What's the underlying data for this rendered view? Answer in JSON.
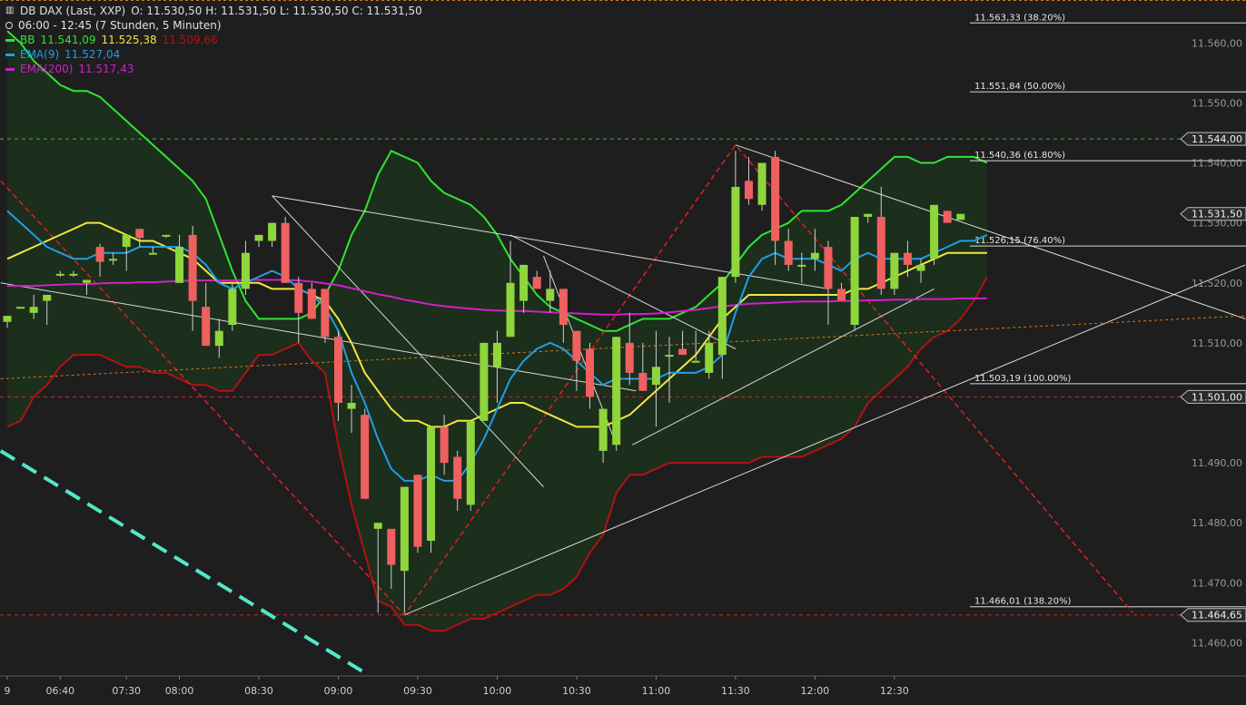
{
  "header": {
    "instrument": "DB DAX (Last, XXP)",
    "ohlc": "O: 11.530,50  H: 11.531,50  L: 11.530,50  C: 11.531,50",
    "timerange": "06:00 - 12:45 (7 Stunden, 5 Minuten)",
    "bb_label": "BB",
    "bb_upper": "11.541,09",
    "bb_mid": "11.525,38",
    "bb_lower": "11.509,66",
    "ema9_label": "EMA(9)",
    "ema9_value": "11.527,04",
    "ema200_label": "EMA(200)",
    "ema200_value": "11.517,43"
  },
  "colors": {
    "background": "#1e1e1e",
    "bb_fill": "#1c2e1c",
    "bb_upper": "#2fe52f",
    "bb_lower": "#b21212",
    "bb_mid": "#f0e640",
    "ema9": "#1f9ee8",
    "ema200": "#d020c8",
    "candle_up": "#8ed63c",
    "candle_down": "#ef6060",
    "fib_line": "#d8d8d8",
    "red_dashed": "#e02020",
    "green_dashed": "#30c030",
    "cyan_dashed": "#50e8c8",
    "orange_dotted": "#d07a1a"
  },
  "chart_data": {
    "type": "candlestick",
    "y_range": [
      11455,
      11567
    ],
    "x_range": [
      0,
      85
    ],
    "y_ticks": [
      "11.560,00",
      "11.550,00",
      "11.540,00",
      "11.530,00",
      "11.520,00",
      "11.510,00",
      "11.490,00",
      "11.480,00",
      "11.470,00",
      "11.460,00"
    ],
    "y_tick_values": [
      11560,
      11550,
      11540,
      11530,
      11520,
      11510,
      11490,
      11480,
      11470,
      11460
    ],
    "x_ticks": [
      {
        "label": "9",
        "bar": 0
      },
      {
        "label": "06:40",
        "bar": 4
      },
      {
        "label": "07:30",
        "bar": 9
      },
      {
        "label": "08:00",
        "bar": 13
      },
      {
        "label": "08:30",
        "bar": 19
      },
      {
        "label": "09:00",
        "bar": 25
      },
      {
        "label": "09:30",
        "bar": 31
      },
      {
        "label": "10:00",
        "bar": 37
      },
      {
        "label": "10:30",
        "bar": 43
      },
      {
        "label": "11:00",
        "bar": 49
      },
      {
        "label": "11:30",
        "bar": 55
      },
      {
        "label": "12:00",
        "bar": 61
      },
      {
        "label": "12:30",
        "bar": 67
      }
    ],
    "candles": [
      {
        "o": 11513.5,
        "h": 11514.5,
        "l": 11512.5,
        "c": 11514.5
      },
      {
        "o": 11516,
        "h": 11516,
        "l": 11516,
        "c": 11516
      },
      {
        "o": 11515,
        "h": 11518,
        "l": 11514,
        "c": 11516
      },
      {
        "o": 11517,
        "h": 11518,
        "l": 11513,
        "c": 11518
      },
      {
        "o": 11521.5,
        "h": 11522,
        "l": 11521,
        "c": 11521.5
      },
      {
        "o": 11521.5,
        "h": 11522,
        "l": 11521,
        "c": 11521.5
      },
      {
        "o": 11520,
        "h": 11520.5,
        "l": 11518,
        "c": 11520.5
      },
      {
        "o": 11526,
        "h": 11526.5,
        "l": 11521,
        "c": 11523.5
      },
      {
        "o": 11524,
        "h": 11525,
        "l": 11523,
        "c": 11524
      },
      {
        "o": 11526,
        "h": 11527,
        "l": 11522,
        "c": 11528
      },
      {
        "o": 11529,
        "h": 11529,
        "l": 11526,
        "c": 11527.5
      },
      {
        "o": 11525,
        "h": 11526,
        "l": 11525,
        "c": 11525
      },
      {
        "o": 11528,
        "h": 11528,
        "l": 11527.5,
        "c": 11528
      },
      {
        "o": 11520,
        "h": 11528,
        "l": 11520,
        "c": 11526
      },
      {
        "o": 11528,
        "h": 11529.5,
        "l": 11512,
        "c": 11517
      },
      {
        "o": 11516,
        "h": 11520,
        "l": 11510,
        "c": 11509.5
      },
      {
        "o": 11509.5,
        "h": 11514,
        "l": 11507.5,
        "c": 11512
      },
      {
        "o": 11513,
        "h": 11520,
        "l": 11512,
        "c": 11519
      },
      {
        "o": 11519,
        "h": 11527,
        "l": 11518,
        "c": 11525
      },
      {
        "o": 11527,
        "h": 11528,
        "l": 11526,
        "c": 11528
      },
      {
        "o": 11527,
        "h": 11529,
        "l": 11526,
        "c": 11530
      },
      {
        "o": 11530,
        "h": 11531,
        "l": 11520,
        "c": 11520
      },
      {
        "o": 11520,
        "h": 11521,
        "l": 11510,
        "c": 11515
      },
      {
        "o": 11519,
        "h": 11520,
        "l": 11514,
        "c": 11514
      },
      {
        "o": 11519,
        "h": 11519,
        "l": 11510,
        "c": 11511
      },
      {
        "o": 11511,
        "h": 11512,
        "l": 11497,
        "c": 11500
      },
      {
        "o": 11499,
        "h": 11503,
        "l": 11495,
        "c": 11500
      },
      {
        "o": 11498,
        "h": 11499,
        "l": 11484,
        "c": 11484
      },
      {
        "o": 11479,
        "h": 11480,
        "l": 11465,
        "c": 11480
      },
      {
        "o": 11479,
        "h": 11479,
        "l": 11469,
        "c": 11473
      },
      {
        "o": 11472,
        "h": 11486,
        "l": 11465,
        "c": 11486
      },
      {
        "o": 11488,
        "h": 11488,
        "l": 11475,
        "c": 11476
      },
      {
        "o": 11477,
        "h": 11496,
        "l": 11475,
        "c": 11496
      },
      {
        "o": 11496,
        "h": 11498,
        "l": 11488,
        "c": 11490
      },
      {
        "o": 11491,
        "h": 11492,
        "l": 11482,
        "c": 11484
      },
      {
        "o": 11483,
        "h": 11497,
        "l": 11482,
        "c": 11497
      },
      {
        "o": 11497,
        "h": 11510,
        "l": 11497,
        "c": 11510
      },
      {
        "o": 11506,
        "h": 11512,
        "l": 11500,
        "c": 11510
      },
      {
        "o": 11511,
        "h": 11527,
        "l": 11511,
        "c": 11520
      },
      {
        "o": 11517,
        "h": 11523,
        "l": 11515,
        "c": 11523
      },
      {
        "o": 11521,
        "h": 11522,
        "l": 11519,
        "c": 11519
      },
      {
        "o": 11517,
        "h": 11522,
        "l": 11515,
        "c": 11519
      },
      {
        "o": 11519,
        "h": 11519,
        "l": 11510,
        "c": 11513
      },
      {
        "o": 11512,
        "h": 11512,
        "l": 11502,
        "c": 11507
      },
      {
        "o": 11509,
        "h": 11510,
        "l": 11499,
        "c": 11501
      },
      {
        "o": 11492,
        "h": 11498,
        "l": 11490,
        "c": 11499
      },
      {
        "o": 11493,
        "h": 11511,
        "l": 11492,
        "c": 11511
      },
      {
        "o": 11510,
        "h": 11515,
        "l": 11503,
        "c": 11505
      },
      {
        "o": 11505,
        "h": 11510,
        "l": 11502,
        "c": 11502
      },
      {
        "o": 11503,
        "h": 11512,
        "l": 11496,
        "c": 11506
      },
      {
        "o": 11508,
        "h": 11511,
        "l": 11500,
        "c": 11508
      },
      {
        "o": 11509,
        "h": 11512,
        "l": 11508,
        "c": 11508
      },
      {
        "o": 11507,
        "h": 11512,
        "l": 11507,
        "c": 11507
      },
      {
        "o": 11505,
        "h": 11512,
        "l": 11504,
        "c": 11510
      },
      {
        "o": 11508,
        "h": 11521,
        "l": 11504,
        "c": 11521
      },
      {
        "o": 11521,
        "h": 11542,
        "l": 11520,
        "c": 11536
      },
      {
        "o": 11537,
        "h": 11541,
        "l": 11533,
        "c": 11534
      },
      {
        "o": 11533,
        "h": 11540,
        "l": 11532,
        "c": 11540
      },
      {
        "o": 11541,
        "h": 11542,
        "l": 11523,
        "c": 11527
      },
      {
        "o": 11527,
        "h": 11529,
        "l": 11522,
        "c": 11523
      },
      {
        "o": 11523,
        "h": 11525,
        "l": 11520,
        "c": 11523
      },
      {
        "o": 11524,
        "h": 11529,
        "l": 11522,
        "c": 11525
      },
      {
        "o": 11526,
        "h": 11527,
        "l": 11513,
        "c": 11519
      },
      {
        "o": 11519,
        "h": 11520,
        "l": 11517,
        "c": 11517
      },
      {
        "o": 11513,
        "h": 11531,
        "l": 11512,
        "c": 11531
      },
      {
        "o": 11531,
        "h": 11531,
        "l": 11530,
        "c": 11531.5
      },
      {
        "o": 11531,
        "h": 11536,
        "l": 11518,
        "c": 11519
      },
      {
        "o": 11519,
        "h": 11525,
        "l": 11518,
        "c": 11525
      },
      {
        "o": 11525,
        "h": 11527,
        "l": 11521,
        "c": 11523
      },
      {
        "o": 11522,
        "h": 11524,
        "l": 11520,
        "c": 11523
      },
      {
        "o": 11524,
        "h": 11533,
        "l": 11523,
        "c": 11533
      },
      {
        "o": 11532,
        "h": 11532,
        "l": 11530,
        "c": 11530
      },
      {
        "o": 11530.5,
        "h": 11531.5,
        "l": 11530.5,
        "c": 11531.5
      }
    ],
    "bb_upper": [
      11562,
      11560,
      11557,
      11555,
      11553,
      11552,
      11552,
      11551,
      11549,
      11547,
      11545,
      11543,
      11541,
      11539,
      11537,
      11534,
      11528,
      11522,
      11517,
      11514,
      11514,
      11514,
      11514,
      11515,
      11518,
      11522,
      11528,
      11532,
      11538,
      11542,
      11541,
      11540,
      11537,
      11535,
      11534,
      11533,
      11531,
      11528,
      11524,
      11521,
      11518,
      11516,
      11515,
      11514,
      11513,
      11512,
      11512,
      11513,
      11514,
      11514,
      11514,
      11515,
      11516,
      11518,
      11520,
      11523,
      11526,
      11528,
      11529,
      11530,
      11532,
      11532,
      11532,
      11533,
      11535,
      11537,
      11539,
      11541,
      11541,
      11540,
      11540,
      11541,
      11541,
      11541,
      11540
    ],
    "bb_mid": [
      11524,
      11525,
      11526,
      11527,
      11528,
      11529,
      11530,
      11530,
      11529,
      11528,
      11527,
      11527,
      11526,
      11525,
      11524,
      11522,
      11520,
      11520,
      11520,
      11520,
      11519,
      11519,
      11519,
      11518,
      11517,
      11514,
      11510,
      11505,
      11502,
      11499,
      11497,
      11497,
      11496,
      11496,
      11497,
      11497,
      11498,
      11499,
      11500,
      11500,
      11499,
      11498,
      11497,
      11496,
      11496,
      11496,
      11497,
      11498,
      11500,
      11502,
      11504,
      11506,
      11508,
      11511,
      11514,
      11516,
      11518,
      11518,
      11518,
      11518,
      11518,
      11518,
      11518,
      11518,
      11519,
      11519,
      11520,
      11521,
      11522,
      11523,
      11524,
      11525,
      11525,
      11525,
      11525
    ],
    "ema9": [
      11532,
      11530,
      11528,
      11526,
      11525,
      11524,
      11524,
      11525,
      11525,
      11525,
      11526,
      11526,
      11526,
      11526,
      11525,
      11523,
      11520,
      11519,
      11520,
      11521,
      11522,
      11521,
      11519,
      11518,
      11516,
      11512,
      11505,
      11500,
      11494,
      11489,
      11487,
      11487,
      11488,
      11487,
      11487,
      11490,
      11494,
      11499,
      11504,
      11507,
      11509,
      11510,
      11509,
      11507,
      11505,
      11503,
      11504,
      11504,
      11504,
      11504,
      11505,
      11505,
      11505,
      11506,
      11508,
      11515,
      11521,
      11524,
      11525,
      11524,
      11524,
      11524,
      11523,
      11522,
      11524,
      11525,
      11524,
      11524,
      11524,
      11524,
      11525,
      11526,
      11527,
      11527,
      11528
    ],
    "ema200": [
      11519.5,
      11519.5,
      11519.5,
      11519.6,
      11519.7,
      11519.8,
      11519.8,
      11519.9,
      11520,
      11520,
      11520.1,
      11520.1,
      11520.2,
      11520.3,
      11520.4,
      11520.4,
      11520.4,
      11520.4,
      11520.5,
      11520.5,
      11520.5,
      11520.5,
      11520.4,
      11520.2,
      11519.9,
      11519.6,
      11519.1,
      11518.6,
      11518.1,
      11517.7,
      11517.2,
      11516.8,
      11516.4,
      11516.1,
      11515.9,
      11515.7,
      11515.5,
      11515.4,
      11515.3,
      11515.3,
      11515.2,
      11515.1,
      11515,
      11514.9,
      11514.8,
      11514.7,
      11514.7,
      11514.8,
      11514.8,
      11514.9,
      11515.1,
      11515.3,
      11515.5,
      11515.8,
      11516.1,
      11516.3,
      11516.5,
      11516.6,
      11516.7,
      11516.8,
      11516.9,
      11516.9,
      11516.9,
      11517,
      11517,
      11517.1,
      11517.1,
      11517.2,
      11517.2,
      11517.3,
      11517.3,
      11517.3,
      11517.4,
      11517.4,
      11517.4
    ],
    "bb_lower": [
      11496,
      11497,
      11501,
      11503,
      11506,
      11508,
      11508,
      11508,
      11507,
      11506,
      11506,
      11505,
      11505,
      11504,
      11503,
      11503,
      11502,
      11502,
      11505,
      11508,
      11508,
      11509,
      11510,
      11507,
      11505,
      11493,
      11483,
      11475,
      11467,
      11466,
      11463,
      11463,
      11462,
      11462,
      11463,
      11464,
      11464,
      11465,
      11466,
      11467,
      11468,
      11468,
      11469,
      11471,
      11475,
      11478,
      11485,
      11488,
      11488,
      11489,
      11490,
      11490,
      11490,
      11490,
      11490,
      11490,
      11490,
      11491,
      11491,
      11491,
      11491,
      11492,
      11493,
      11494,
      11496,
      11500,
      11502,
      11504,
      11506,
      11509,
      11511,
      11512,
      11514,
      11517,
      11521
    ],
    "fib_levels": [
      {
        "label": "11.563,33 (38.20%)",
        "value": 11563.33
      },
      {
        "label": "11.551,84 (50.00%)",
        "value": 11551.84
      },
      {
        "label": "11.540,36 (61.80%)",
        "value": 11540.36
      },
      {
        "label": "11.526,15 (76.40%)",
        "value": 11526.15
      },
      {
        "label": "11.503,19 (100.00%)",
        "value": 11503.19
      },
      {
        "label": "11.466,01 (138.20%)",
        "value": 11466.01
      }
    ],
    "price_markers": [
      {
        "label": "11.544,00",
        "value": 11544
      },
      {
        "label": "11.531,50",
        "value": 11531.5
      },
      {
        "label": "11.501,00",
        "value": 11501
      },
      {
        "label": "11.464,65",
        "value": 11464.65
      }
    ],
    "horizontal_levels": [
      {
        "value": 11544,
        "style": "green-dashed"
      },
      {
        "value": 11501,
        "style": "red-dashed"
      },
      {
        "value": 11464.65,
        "style": "red-dashed"
      }
    ],
    "trend_lines": [
      {
        "style": "red-dashed",
        "points": [
          [
            -0.5,
            11537
          ],
          [
            30,
            11464.65
          ],
          [
            55,
            11543
          ],
          [
            85,
            11465
          ]
        ]
      },
      {
        "style": "white",
        "points": [
          [
            20,
            11534.5
          ],
          [
            40.5,
            11486
          ]
        ]
      },
      {
        "style": "white",
        "points": [
          [
            20,
            11534.5
          ],
          [
            62,
            11519
          ]
        ]
      },
      {
        "style": "white",
        "points": [
          [
            38,
            11528
          ],
          [
            55,
            11509
          ]
        ]
      },
      {
        "style": "white",
        "points": [
          [
            40.5,
            11524.5
          ],
          [
            46,
            11493
          ]
        ]
      },
      {
        "style": "white",
        "points": [
          [
            55,
            11543
          ],
          [
            93.5,
            11514
          ]
        ]
      },
      {
        "style": "white",
        "points": [
          [
            30,
            11464.65
          ],
          [
            93.5,
            11523
          ]
        ]
      },
      {
        "style": "white",
        "points": [
          [
            47.2,
            11493
          ],
          [
            70,
            11519
          ]
        ]
      },
      {
        "style": "white",
        "points": [
          [
            -0.5,
            11520
          ],
          [
            47.5,
            11502
          ]
        ]
      },
      {
        "style": "orange-dotted",
        "points": [
          [
            -0.5,
            11504
          ],
          [
            93.5,
            11514.5
          ]
        ]
      },
      {
        "style": "cyan-dashed",
        "points": [
          [
            -0.5,
            11492
          ],
          [
            27,
            11455
          ]
        ]
      }
    ]
  }
}
